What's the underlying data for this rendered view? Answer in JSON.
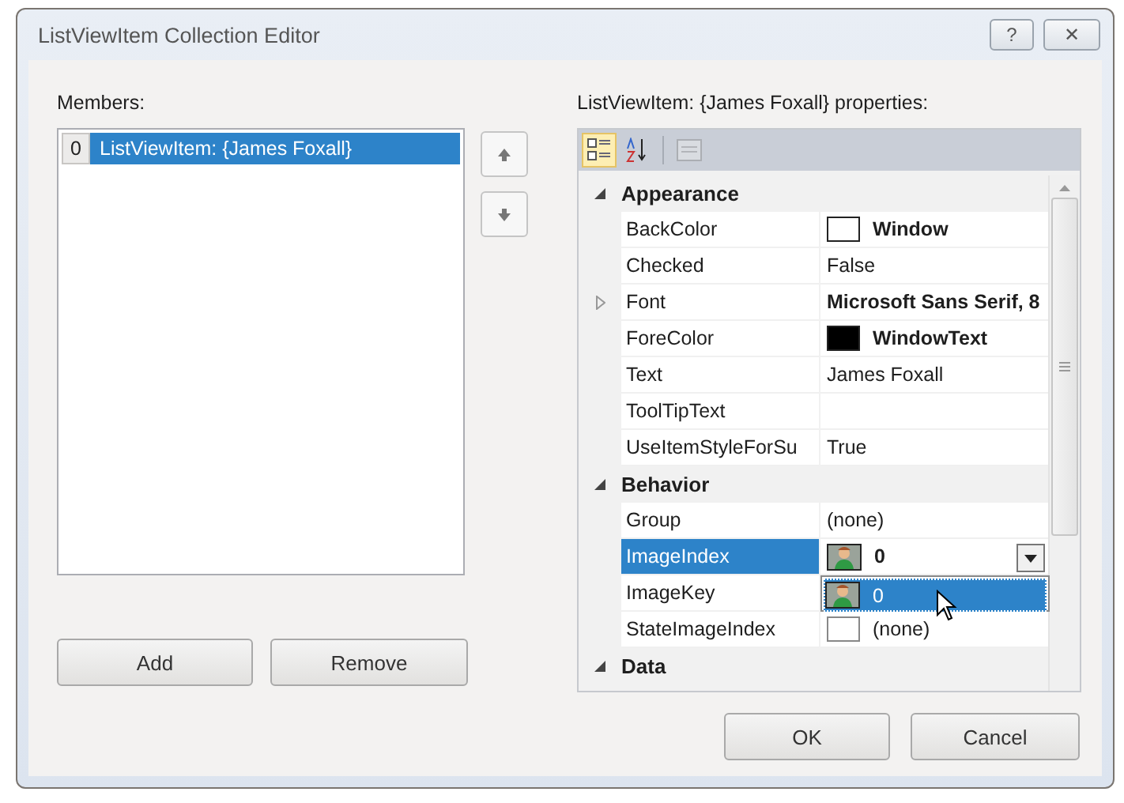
{
  "window": {
    "title": "ListViewItem Collection Editor",
    "buttons": [
      {
        "kind": "help",
        "label": "?"
      },
      {
        "kind": "close",
        "label": "✕"
      }
    ]
  },
  "members": {
    "label": "Members:",
    "items": [
      {
        "index": "0",
        "label": "ListViewItem: {James Foxall}",
        "selected": true
      }
    ],
    "add": "Add",
    "remove": "Remove"
  },
  "properties": {
    "label": "ListViewItem: {James Foxall} properties:",
    "toolbar": [
      {
        "kind": "categorized",
        "selected": true,
        "disabled": false
      },
      {
        "kind": "alphabetical",
        "selected": false,
        "disabled": false
      },
      {
        "kind": "pages",
        "selected": false,
        "disabled": true
      }
    ],
    "categories": [
      {
        "name": "Appearance",
        "expanded": true,
        "properties": [
          {
            "name": "BackColor",
            "kind": "color",
            "color": "#ffffff",
            "value": "Window",
            "bold": true,
            "selected": false,
            "expandable": false
          },
          {
            "name": "Checked",
            "kind": "text",
            "value": "False",
            "bold": false,
            "selected": false,
            "expandable": false
          },
          {
            "name": "Font",
            "kind": "text",
            "value": "Microsoft Sans Serif, 8",
            "bold": true,
            "selected": false,
            "expandable": true
          },
          {
            "name": "ForeColor",
            "kind": "color",
            "color": "#000000",
            "value": "WindowText",
            "bold": true,
            "selected": false,
            "expandable": false
          },
          {
            "name": "Text",
            "kind": "text",
            "value": "James Foxall",
            "bold": false,
            "selected": false,
            "expandable": false
          },
          {
            "name": "ToolTipText",
            "kind": "text",
            "selected": false,
            "expandable": false
          },
          {
            "name": "UseItemStyleForSu",
            "kind": "text",
            "value": "True",
            "bold": false,
            "selected": false,
            "expandable": false
          }
        ]
      },
      {
        "name": "Behavior",
        "expanded": true,
        "properties": [
          {
            "name": "Group",
            "kind": "text",
            "value": "(none)",
            "bold": false,
            "selected": false,
            "expandable": false
          },
          {
            "name": "ImageIndex",
            "kind": "image",
            "value": "0",
            "bold": true,
            "selected": true,
            "expandable": false,
            "dropdown": {
              "open": true,
              "items": [
                {
                  "label": "0",
                  "selected": true
                }
              ]
            }
          },
          {
            "name": "ImageKey",
            "kind": "text",
            "selected": false,
            "expandable": false
          },
          {
            "name": "StateImageIndex",
            "kind": "blank-image",
            "value": "(none)",
            "bold": false,
            "selected": false,
            "expandable": false
          }
        ]
      },
      {
        "name": "Data",
        "expanded": true
      }
    ]
  },
  "buttons": [
    {
      "label": "OK"
    },
    {
      "label": "Cancel"
    }
  ]
}
